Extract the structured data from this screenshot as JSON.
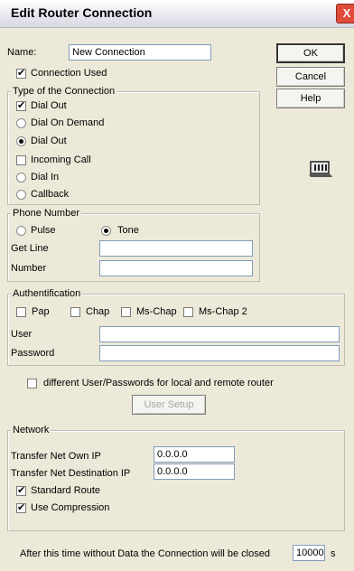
{
  "window": {
    "title": "Edit Router Connection",
    "close_glyph": "X"
  },
  "name": {
    "label": "Name:",
    "value": "New Connection"
  },
  "connection_used": {
    "label": "Connection Used",
    "checked": true
  },
  "buttons": {
    "ok": "OK",
    "cancel": "Cancel",
    "help": "Help",
    "user_setup": "User Setup"
  },
  "connection_type": {
    "title": "Type of the Connection",
    "dial_out_check": {
      "label": "Dial Out",
      "checked": true
    },
    "radios1": [
      {
        "label": "Dial On Demand",
        "selected": false
      },
      {
        "label": "Dial Out",
        "selected": true
      }
    ],
    "incoming_call": {
      "label": "Incoming Call",
      "checked": false
    },
    "radios2": [
      {
        "label": "Dial In",
        "selected": false
      },
      {
        "label": "Callback",
        "selected": false
      }
    ]
  },
  "phone": {
    "title": "Phone Number",
    "pulse": {
      "label": "Pulse",
      "selected": false
    },
    "tone": {
      "label": "Tone",
      "selected": true
    },
    "get_line": {
      "label": "Get Line",
      "value": ""
    },
    "number": {
      "label": "Number",
      "value": ""
    }
  },
  "auth": {
    "title": "Authentification",
    "methods": [
      {
        "label": "Pap",
        "checked": false
      },
      {
        "label": "Chap",
        "checked": false
      },
      {
        "label": "Ms-Chap",
        "checked": false
      },
      {
        "label": "Ms-Chap 2",
        "checked": false
      }
    ],
    "user": {
      "label": "User",
      "value": ""
    },
    "password": {
      "label": "Password",
      "value": ""
    }
  },
  "different_users": {
    "label": "different User/Passwords for local and remote router",
    "checked": false
  },
  "network": {
    "title": "Network",
    "own_ip": {
      "label": "Transfer Net Own IP",
      "value": "0.0.0.0"
    },
    "dest_ip": {
      "label": "Transfer Net Destination IP",
      "value": "0.0.0.0"
    },
    "standard_route": {
      "label": "Standard Route",
      "checked": true
    },
    "use_compression": {
      "label": "Use Compression",
      "checked": true
    }
  },
  "timeout": {
    "label": "After this time without Data the Connection will be closed",
    "value": "10000",
    "unit": "s"
  },
  "icons": {
    "router": "router-icon"
  }
}
